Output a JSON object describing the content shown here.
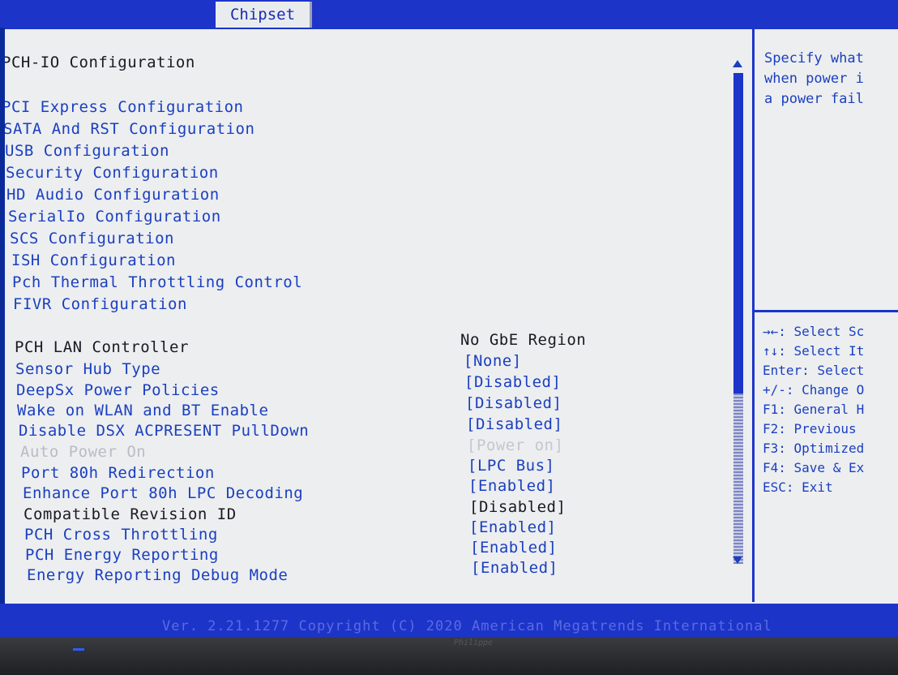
{
  "tabs": {
    "active": "Chipset"
  },
  "page_title": "PCH-IO Configuration",
  "submenus": [
    "PCI Express Configuration",
    "SATA And RST Configuration",
    "USB Configuration",
    "Security Configuration",
    "HD Audio Configuration",
    "SerialIo Configuration",
    "SCS Configuration",
    "ISH Configuration",
    "Pch Thermal Throttling Control",
    "FIVR Configuration"
  ],
  "settings": [
    {
      "label": "PCH LAN Controller",
      "value": "No GbE Region"
    },
    {
      "label": "Sensor Hub Type",
      "value": "[None]"
    },
    {
      "label": "DeepSx Power Policies",
      "value": "[Disabled]"
    },
    {
      "label": "Wake on WLAN and BT Enable",
      "value": "[Disabled]"
    },
    {
      "label": "Disable DSX ACPRESENT PullDown",
      "value": "[Disabled]"
    },
    {
      "label": "Auto Power On",
      "value": "[Power on]"
    },
    {
      "label": "Port 80h Redirection",
      "value": "[LPC Bus]"
    },
    {
      "label": "Enhance Port 80h LPC Decoding",
      "value": "[Enabled]"
    },
    {
      "label": "Compatible Revision ID",
      "value": "[Disabled]"
    },
    {
      "label": "PCH Cross Throttling",
      "value": "[Enabled]"
    },
    {
      "label": "PCH Energy Reporting",
      "value": "[Enabled]"
    },
    {
      "label": "Energy Reporting Debug Mode",
      "value": "[Enabled]"
    }
  ],
  "help": {
    "lines": [
      "Specify what",
      "when power i",
      "a power fail"
    ]
  },
  "keys": [
    "→←: Select Sc",
    "↑↓: Select It",
    "Enter: Select",
    "+/-: Change O",
    "F1: General H",
    "F2: Previous",
    "F3: Optimized",
    "F4: Save & Ex",
    "ESC: Exit"
  ],
  "footer": {
    "text": "Ver. 2.21.1277 Copyright (C) 2020 American Megatrends International"
  },
  "bezel": {
    "brand": "Philippe"
  },
  "colors": {
    "background": "#eceef0",
    "accent": "#1d34c9",
    "link": "#1b3fbf",
    "text": "#1a1a22",
    "disabled": "#b9bcc4"
  }
}
